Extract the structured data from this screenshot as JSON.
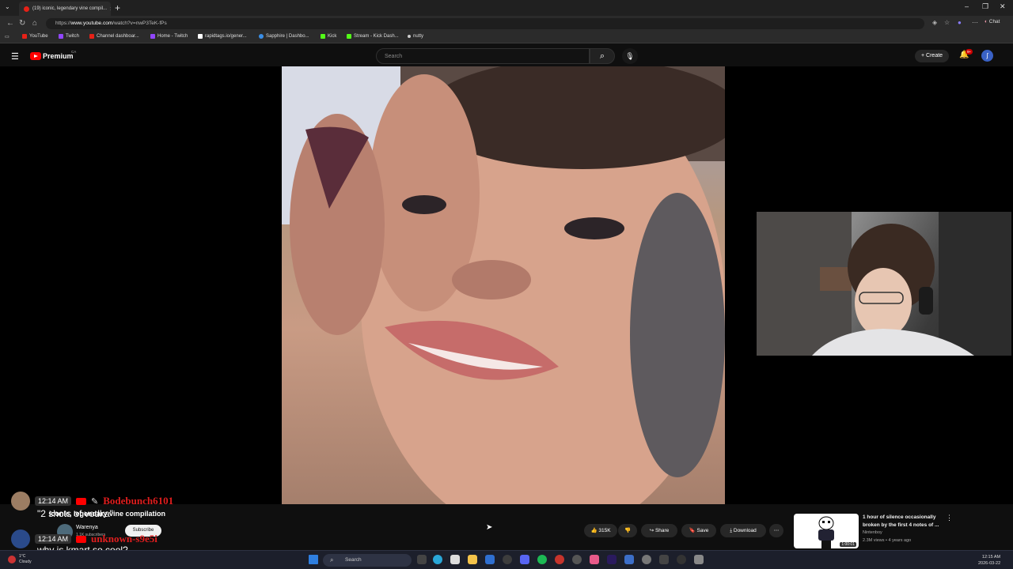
{
  "browser": {
    "tab_title": "(19) iconic, legendary vine compil...",
    "url_prefix": "https://",
    "url_domain": "www.youtube.com",
    "url_path": "/watch?v=nwP3TeK-fPs",
    "chat_label": "Chat"
  },
  "bookmarks": [
    {
      "label": "YouTube",
      "color": "#e62117"
    },
    {
      "label": "Twitch",
      "color": "#9146ff"
    },
    {
      "label": "Channel dashboar...",
      "color": "#e62117"
    },
    {
      "label": "Home - Twitch",
      "color": "#9146ff"
    },
    {
      "label": "rapidtags.io/gener...",
      "color": "#ffffff"
    },
    {
      "label": "Sapphire | Dashbo...",
      "color": "#3a8ee6"
    },
    {
      "label": "Kick",
      "color": "#53fc18"
    },
    {
      "label": "Stream - Kick Dash...",
      "color": "#53fc18"
    },
    {
      "label": "nutty",
      "color": "#cccccc"
    }
  ],
  "youtube": {
    "premium_label": "Premium",
    "country": "CA",
    "search_placeholder": "Search",
    "create_label": "Create",
    "notif_badge": "9+"
  },
  "chat_overlay": {
    "line1": {
      "time": "12:14 AM",
      "user": "Bodebunch6101",
      "message": "\"2 shots of vodka\""
    },
    "line2": {
      "time": "12:14 AM",
      "user": "unknown-s9e5i",
      "message": "why is kmart so cool?"
    }
  },
  "video": {
    "title": "iconic, legendary vine compilation",
    "channel": "Warenya",
    "subscribers": "1.1K subscribers",
    "subscribe_label": "Subscribe",
    "likes": "315K",
    "share_label": "Share",
    "save_label": "Save",
    "download_label": "Download"
  },
  "recommended": {
    "title": "1 hour of silence occasionally broken by the first 4 notes of ...",
    "channel": "Nintenboy",
    "meta": "2.3M views • 4 years ago",
    "duration": "1:00:01"
  },
  "taskbar": {
    "temp": "1°C",
    "weather": "Cloudy",
    "search_label": "Search",
    "time": "12:15 AM",
    "date": "2026-03-22"
  }
}
